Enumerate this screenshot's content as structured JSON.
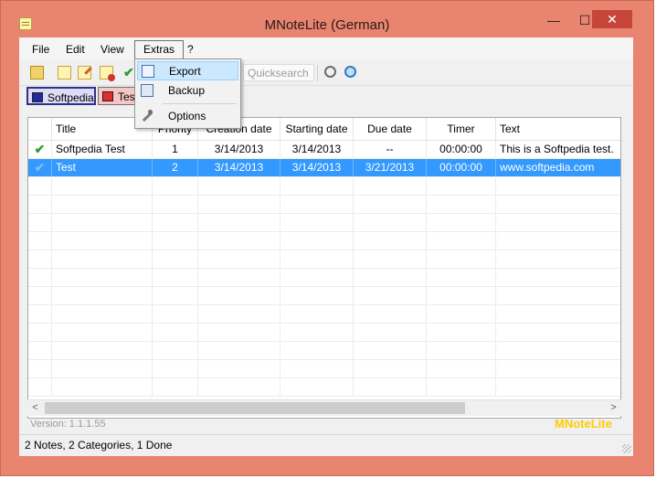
{
  "window": {
    "title": "MNoteLite (German)",
    "min_glyph": "—",
    "max_glyph": "☐",
    "close_glyph": "✕"
  },
  "menu": {
    "file": "File",
    "edit": "Edit",
    "view": "View",
    "extras": "Extras",
    "help": "?"
  },
  "toolbar": {
    "quicksearch_placeholder": "Quicksearch"
  },
  "categories": [
    {
      "label": "Softpedia",
      "color": "#1f2aa0"
    },
    {
      "label": "Test",
      "color": "#e0302c"
    }
  ],
  "table": {
    "columns": [
      "Title",
      "Priority",
      "Creation date",
      "Starting date",
      "Due date",
      "Timer",
      "Text"
    ],
    "rows": [
      {
        "done": "✔",
        "title": "Softpedia Test",
        "priority": "1",
        "created": "3/14/2013",
        "start": "3/14/2013",
        "due": "--",
        "timer": "00:00:00",
        "text": "This is a Softpedia test."
      },
      {
        "done": "✔",
        "title": "Test",
        "priority": "2",
        "created": "3/14/2013",
        "start": "3/14/2013",
        "due": "3/21/2013",
        "timer": "00:00:00",
        "text": "www.softpedia.com"
      }
    ]
  },
  "scroll": {
    "left": "<",
    "right": ">"
  },
  "extras_menu": {
    "export": "Export",
    "backup": "Backup",
    "options": "Options"
  },
  "version": "Version: 1.1.1.55",
  "brand": "MNoteLite",
  "status": "2 Notes, 2 Categories, 1 Done"
}
